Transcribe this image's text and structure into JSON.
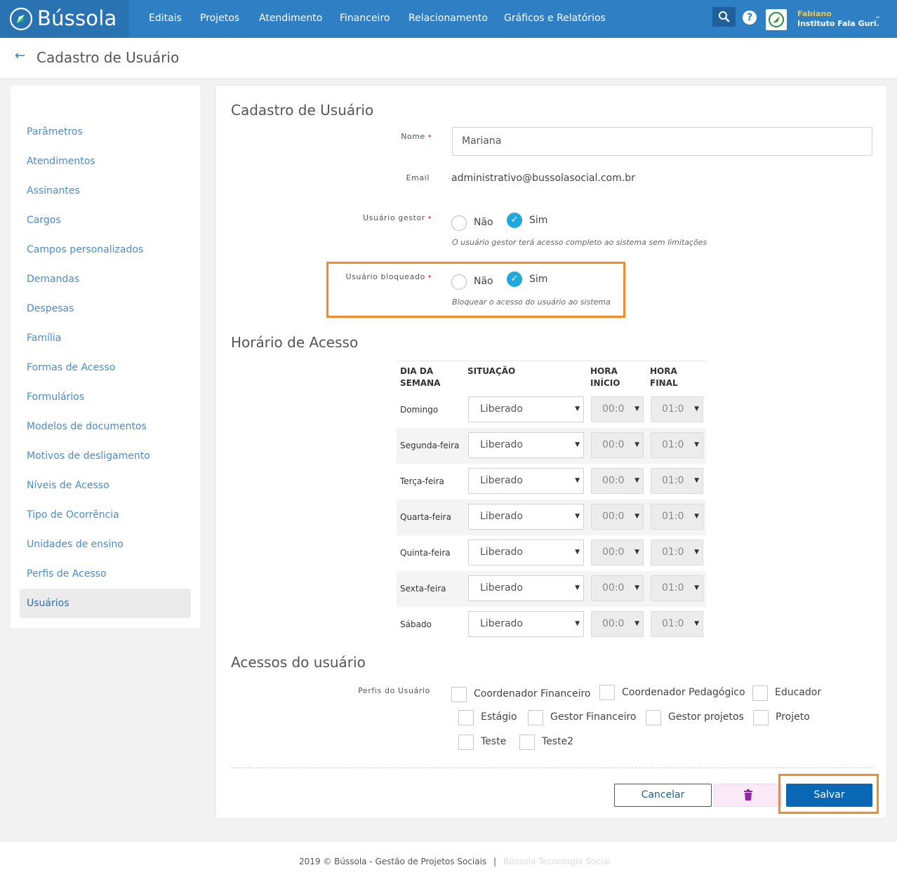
{
  "brand": {
    "name": "Bússola",
    "logo_icon": "compass-logo-icon"
  },
  "nav": {
    "items": [
      "Editais",
      "Projetos",
      "Atendimento",
      "Financeiro",
      "Relacionamento",
      "Gráficos e Relatórios"
    ],
    "search_icon": "search-icon",
    "help_icon": "help-icon",
    "user": {
      "name": "Fabiano",
      "organization": "Instituto Fala Guri."
    }
  },
  "header": {
    "back_icon": "arrow-left-icon",
    "title": "Cadastro de Usuário"
  },
  "sidebar": {
    "items": [
      "Parâmetros",
      "Atendimentos",
      "Assinantes",
      "Cargos",
      "Campos personalizados",
      "Demandas",
      "Despesas",
      "Família",
      "Formas de Acesso",
      "Formulários",
      "Modelos de documentos",
      "Motivos de desligamento",
      "Níveis de Acesso",
      "Tipo de Ocorrência",
      "Unidades de ensino",
      "Perfis de Acesso",
      "Usuários"
    ],
    "active": "Usuários"
  },
  "form": {
    "title": "Cadastro de Usuário",
    "nome": {
      "label": "Nome",
      "value": "Mariana"
    },
    "email": {
      "label": "Email",
      "value": "administrativo@bussolasocial.com.br"
    },
    "gestor": {
      "label": "Usuário gestor",
      "options": [
        "Não",
        "Sim"
      ],
      "selected": "Sim",
      "help": "O usuário gestor terá acesso completo ao sistema sem limitações"
    },
    "bloqueado": {
      "label": "Usuário bloqueado",
      "options": [
        "Não",
        "Sim"
      ],
      "selected": "Sim",
      "help": "Bloquear o acesso do usuário ao sistema"
    }
  },
  "schedule": {
    "title": "Horário de Acesso",
    "headers": {
      "day": [
        "DIA DA",
        "SEMANA"
      ],
      "status": "SITUAÇÃO",
      "start": [
        "HORA",
        "INÍCIO"
      ],
      "end": [
        "HORA",
        "FINAL"
      ]
    },
    "rows": [
      {
        "day": "Domingo",
        "status": "Liberado",
        "start": "00:0",
        "end": "01:0"
      },
      {
        "day": "Segunda-feira",
        "status": "Liberado",
        "start": "00:0",
        "end": "01:0"
      },
      {
        "day": "Terça-feira",
        "status": "Liberado",
        "start": "00:0",
        "end": "01:0"
      },
      {
        "day": "Quarta-feira",
        "status": "Liberado",
        "start": "00:0",
        "end": "01:0"
      },
      {
        "day": "Quinta-feira",
        "status": "Liberado",
        "start": "00:0",
        "end": "01:0"
      },
      {
        "day": "Sexta-feira",
        "status": "Liberado",
        "start": "00:0",
        "end": "01:0"
      },
      {
        "day": "Sábado",
        "status": "Liberado",
        "start": "00:0",
        "end": "01:0"
      }
    ]
  },
  "access": {
    "title": "Acessos do usuário",
    "profiles_label": "Perfis do Usuário",
    "profiles": [
      "Coordenador Financeiro",
      "Coordenador Pedagógico",
      "Educador",
      "Estágio",
      "Gestor Financeiro",
      "Gestor projetos",
      "Projeto",
      "Teste",
      "Teste2"
    ]
  },
  "actions": {
    "cancel": "Cancelar",
    "delete_icon": "trash-icon",
    "save": "Salvar"
  },
  "footer": {
    "copyright": "2019 © Bússola - Gestão de Projetos Sociais",
    "separator": "|",
    "link": "Bússola Tecnologia Social"
  },
  "colors": {
    "nav": "#2f7fc4",
    "accent": "#1fa8dc",
    "highlight": "#f28a2e",
    "save": "#0a67b3"
  }
}
